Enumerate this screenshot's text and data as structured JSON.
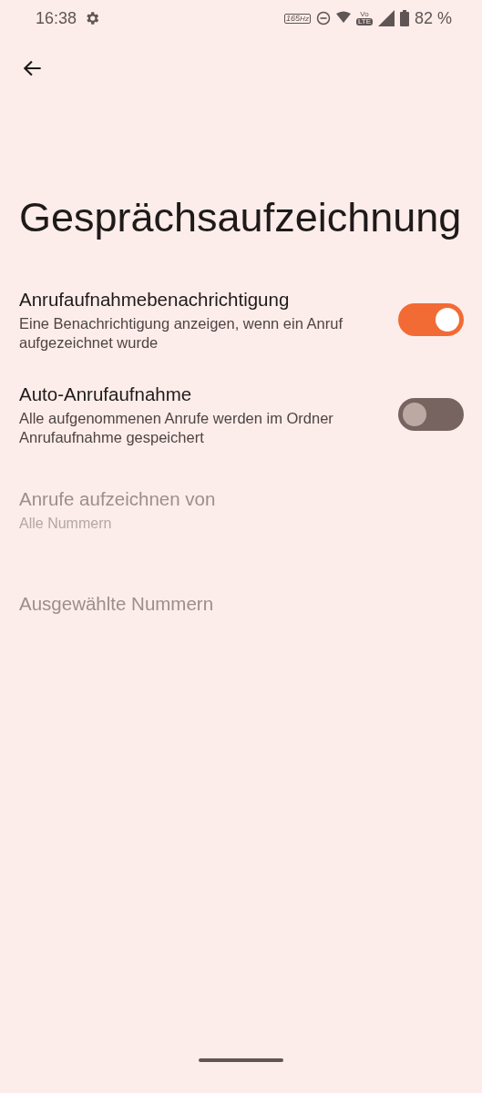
{
  "status_bar": {
    "time": "16:38",
    "refresh_rate": {
      "value": "165",
      "unit": "Hz"
    },
    "volte": {
      "top": "Vo",
      "badge": "LTE"
    },
    "battery": "82 %"
  },
  "title": "Gesprächsaufzeichnung",
  "settings": [
    {
      "kind": "toggle",
      "title": "Anrufaufnahmebenachrichtigung",
      "summary": "Eine Benachrichtigung anzeigen, wenn ein Anruf aufgezeichnet wurde",
      "on": true,
      "disabled": false
    },
    {
      "kind": "toggle",
      "title": "Auto-Anrufaufnahme",
      "summary": "Alle aufgenommenen Anrufe werden im Ordner Anrufaufnahme gespeichert",
      "on": false,
      "disabled": false
    },
    {
      "kind": "item",
      "title": "Anrufe aufzeichnen von",
      "summary": "Alle Nummern",
      "disabled": true
    },
    {
      "kind": "item",
      "title": "Ausgewählte Nummern",
      "disabled": true
    }
  ]
}
